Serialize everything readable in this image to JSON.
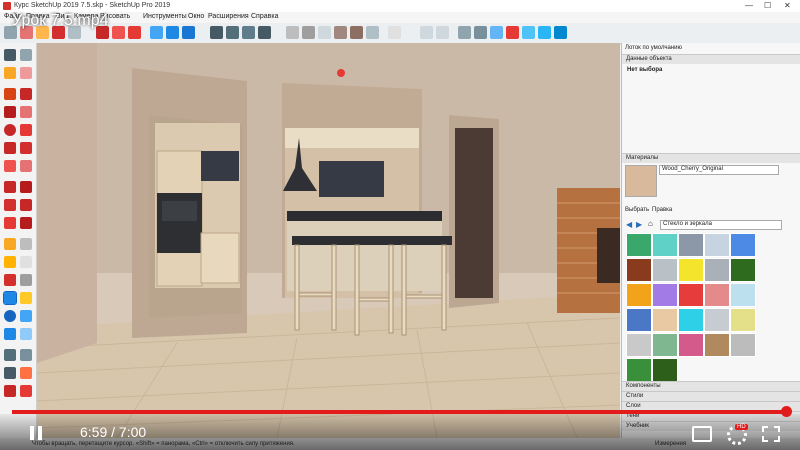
{
  "window": {
    "title": "Курс SketchUp 2019 7.5.skp - SketchUp Pro 2019",
    "min": "—",
    "max": "☐",
    "close": "✕"
  },
  "menu": [
    "Файл",
    "Правка",
    "Вид",
    "Камера",
    "Рисовать",
    "Инструменты",
    "Окно",
    "Расширения",
    "Справка"
  ],
  "video": {
    "title": "Урок 7.5.mp4",
    "time": "6:59 / 7:00",
    "progress": 0.998,
    "hd_badge": "HD"
  },
  "panel": {
    "tray_title": "Лоток по умолчанию",
    "entity_info": {
      "header": "Данные объекта",
      "value": "Нет выбора"
    },
    "materials": {
      "header": "Материалы",
      "current": "Wood_Cherry_Original",
      "tab_select": "Выбрать",
      "tab_edit": "Правка",
      "library": "Стекло и зеркала"
    },
    "sections": [
      "Компоненты",
      "Стили",
      "Слои",
      "Тени",
      "Учебник"
    ]
  },
  "status": {
    "hint": "Чтобы вращать, перетащите курсор. «Shift» = панорама, «Ctrl» = отключить силу притяжения.",
    "measure_label": "Измерения"
  },
  "colors": {
    "progress": "#e21b1b",
    "accent": "#2a6fb8"
  }
}
